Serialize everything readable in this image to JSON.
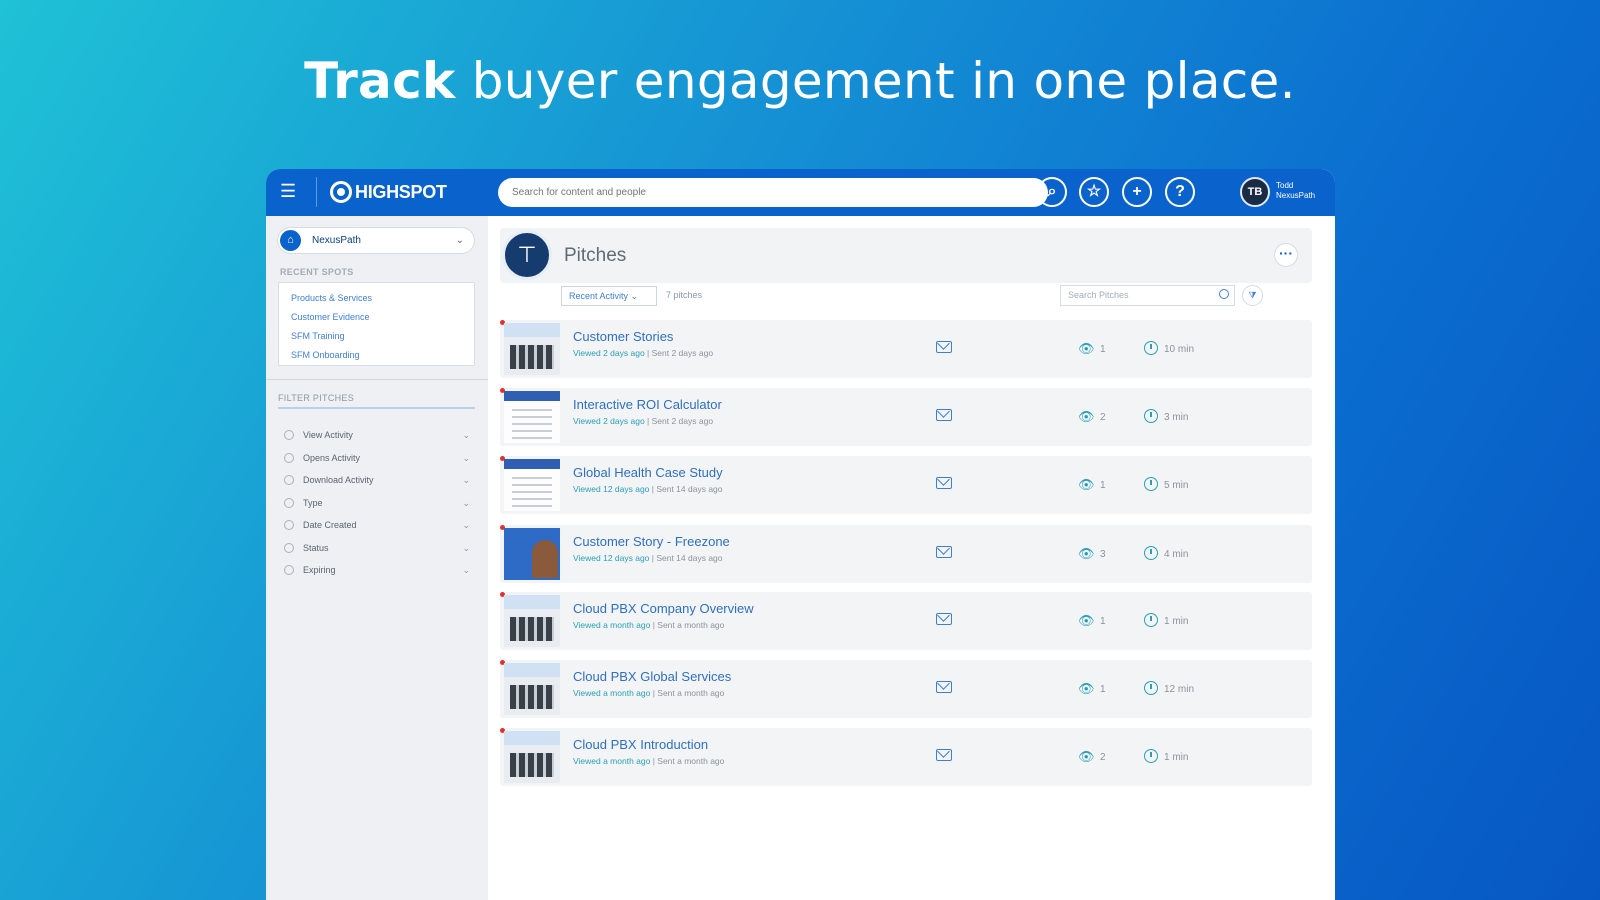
{
  "headline": {
    "bold": "Track",
    "rest": " buyer engagement in one place."
  },
  "topbar": {
    "brand": "HIGHSPOT",
    "search_placeholder": "Search for content and people",
    "avatar_initials": "TB",
    "user_name_line1": "Todd",
    "user_name_line2": "NexusPath"
  },
  "sidebar": {
    "spot_name": "NexusPath",
    "recent_heading": "RECENT SPOTS",
    "recent_spots": [
      "Products & Services",
      "Customer Evidence",
      "SFM Training",
      "SFM Onboarding"
    ],
    "filter_heading": "FILTER PITCHES",
    "filters": [
      "View Activity",
      "Opens Activity",
      "Download Activity",
      "Type",
      "Date Created",
      "Status",
      "Expiring"
    ]
  },
  "main": {
    "title": "Pitches",
    "sort_label": "Recent Activity",
    "count_label": "7 pitches",
    "search_placeholder": "Search Pitches",
    "pitches": [
      {
        "title": "Customer Stories",
        "viewed": "Viewed 2 days ago",
        "sent": " | Sent 2 days ago",
        "views": "1",
        "duration": "10 min"
      },
      {
        "title": "Interactive ROI Calculator",
        "viewed": "Viewed 2 days ago",
        "sent": " | Sent 2 days ago",
        "views": "2",
        "duration": "3 min"
      },
      {
        "title": "Global Health Case Study",
        "viewed": "Viewed 12 days ago",
        "sent": " | Sent 14 days ago",
        "views": "1",
        "duration": "5 min"
      },
      {
        "title": "Customer Story - Freezone",
        "viewed": "Viewed 12 days ago",
        "sent": " | Sent 14 days ago",
        "views": "3",
        "duration": "4 min"
      },
      {
        "title": "Cloud PBX Company Overview",
        "viewed": "Viewed a month ago",
        "sent": " | Sent a month ago",
        "views": "1",
        "duration": "1 min"
      },
      {
        "title": "Cloud PBX Global Services",
        "viewed": "Viewed a month ago",
        "sent": " | Sent a month ago",
        "views": "1",
        "duration": "12 min"
      },
      {
        "title": "Cloud PBX Introduction",
        "viewed": "Viewed a month ago",
        "sent": " | Sent a month ago",
        "views": "2",
        "duration": "1 min"
      }
    ]
  },
  "colors": {
    "brand": "#0a63cc",
    "accent_teal": "#2a9fb5",
    "unread_dot": "#e2322d"
  },
  "icons": {
    "topbar": [
      "menu-icon",
      "search-icon",
      "star-icon",
      "plus-icon",
      "help-icon"
    ],
    "row": [
      "mail-icon",
      "eye-icon",
      "clock-icon"
    ]
  }
}
